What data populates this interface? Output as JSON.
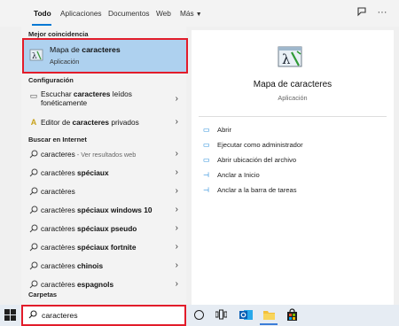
{
  "tabs": {
    "todo": "Todo",
    "aplicaciones": "Aplicaciones",
    "documentos": "Documentos",
    "web": "Web",
    "mas": "Más"
  },
  "sections": {
    "best_match": "Mejor coincidencia",
    "configuracion": "Configuración",
    "buscar_internet": "Buscar en Internet",
    "carpetas": "Carpetas"
  },
  "best_match": {
    "title_pre": "Mapa de ",
    "title_bold": "caracteres",
    "subtitle": "Aplicación"
  },
  "config_items": [
    {
      "pre": "Escuchar ",
      "bold": "caracteres",
      "post": " leídos",
      "line2": "fonéticamente"
    },
    {
      "pre": "Editor de ",
      "bold": "caracteres",
      "post": " privados"
    }
  ],
  "web_items": [
    {
      "bold": "",
      "plain": "caracteres",
      "sub": " - Ver resultados web"
    },
    {
      "plain": "caractères ",
      "bold": "spéciaux"
    },
    {
      "plain": "caractères",
      "bold": ""
    },
    {
      "plain": "caractères ",
      "bold": "spéciaux windows 10"
    },
    {
      "plain": "caractères ",
      "bold": "spéciaux pseudo"
    },
    {
      "plain": "caractères ",
      "bold": "spéciaux fortnite"
    },
    {
      "plain": "caractères ",
      "bold": "chinois"
    },
    {
      "plain": "caractères ",
      "bold": "espagnols"
    }
  ],
  "preview": {
    "name": "Mapa de caracteres",
    "type": "Aplicación",
    "actions": [
      "Abrir",
      "Ejecutar como administrador",
      "Abrir ubicación del archivo",
      "Anclar a Inicio",
      "Anclar a la barra de tareas"
    ]
  },
  "search": {
    "value": "caracteres"
  },
  "colors": {
    "accent": "#0078d4",
    "highlight": "#aed1ef",
    "annotation_red": "#e21c2a"
  }
}
